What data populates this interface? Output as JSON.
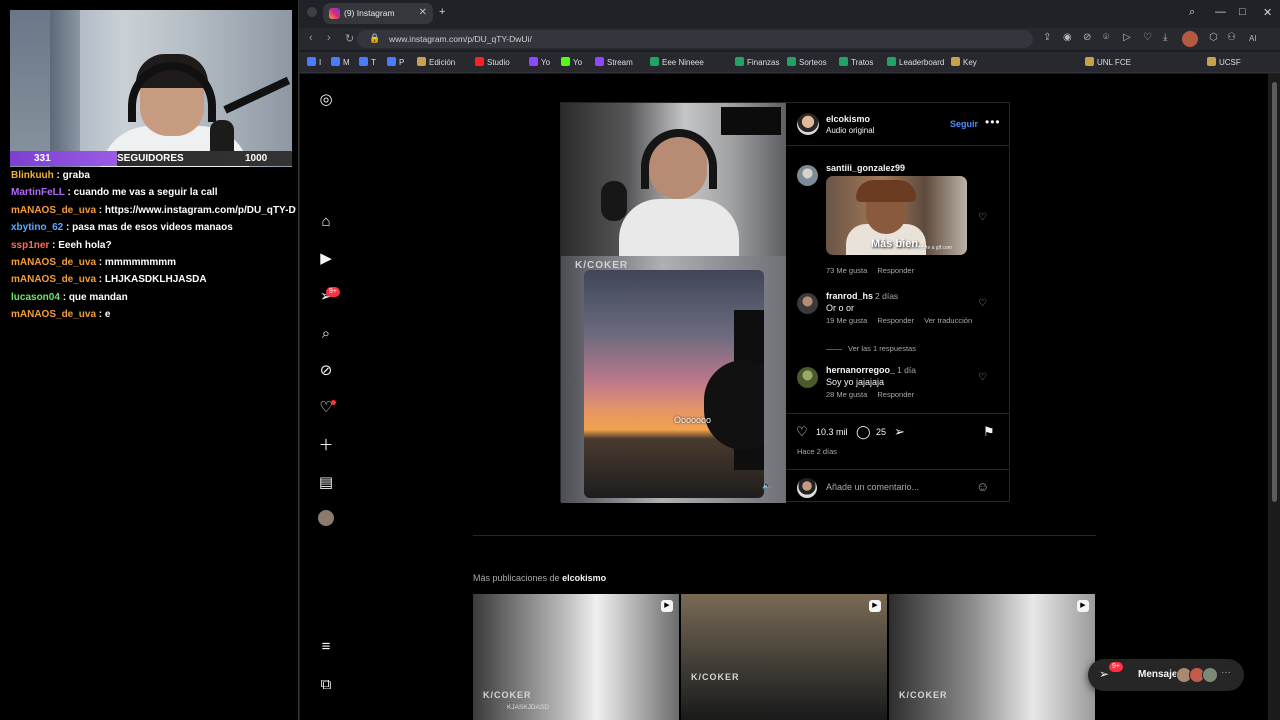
{
  "stream": {
    "followers": {
      "current": "331",
      "label": "SEGUIDORES",
      "goal": "1000"
    },
    "chat": [
      {
        "user": "Blinkuuh",
        "color": "#f0b232",
        "text": "graba"
      },
      {
        "user": "MartinFeLL",
        "color": "#b06bf5",
        "text": "cuando me vas a seguir la call"
      },
      {
        "user": "mANAOS_de_uva",
        "color": "#f59e3a",
        "text": "https://www.instagram.com/p/DU_qTY-DwUi/"
      },
      {
        "user": "xbytino_62",
        "color": "#5fa8ff",
        "text": "pasa mas de esos videos manaos"
      },
      {
        "user": "ssp1ner",
        "color": "#ff6b5a",
        "text": "Eeeh hola?"
      },
      {
        "user": "mANAOS_de_uva",
        "color": "#f59e3a",
        "text": "mmmmmmmm"
      },
      {
        "user": "mANAOS_de_uva",
        "color": "#f59e3a",
        "text": "LHJKASDKLHJASDA"
      },
      {
        "user": "lucason04",
        "color": "#6ee36e",
        "text": "que mandan"
      },
      {
        "user": "mANAOS_de_uva",
        "color": "#f59e3a",
        "text": "e"
      }
    ]
  },
  "browser": {
    "tab_title": "(9) Instagram",
    "url": "www.instagram.com/p/DU_qTY-DwUi/",
    "ai_label": "AI",
    "bookmarks": [
      {
        "label": "I",
        "color": "#4a7cff"
      },
      {
        "label": "M",
        "color": "#4a7cff"
      },
      {
        "label": "T",
        "color": "#4a7cff"
      },
      {
        "label": "P",
        "color": "#4a7cff"
      },
      {
        "label": "Edición",
        "color": "#c8a24a"
      },
      {
        "label": "Studio",
        "color": "#ff2020"
      },
      {
        "label": "Yo",
        "color": "#9146ff"
      },
      {
        "label": "Yo",
        "color": "#53fc18"
      },
      {
        "label": "Stream",
        "color": "#9146ff"
      },
      {
        "label": "Eee Nineee",
        "color": "#21a366"
      },
      {
        "label": "Finanzas",
        "color": "#21a366"
      },
      {
        "label": "Sorteos",
        "color": "#21a366"
      },
      {
        "label": "Tratos",
        "color": "#21a366"
      },
      {
        "label": "Leaderboard",
        "color": "#21a366"
      },
      {
        "label": "Key",
        "color": "#c8a24a"
      },
      {
        "label": "UNL FCE",
        "color": "#c8a24a"
      },
      {
        "label": "UCSF",
        "color": "#c8a24a"
      }
    ]
  },
  "post": {
    "author": "elcokismo",
    "audio": "Audio original",
    "follow_label": "Seguir",
    "media_watermark": "K/COKER",
    "media_caption": "Ooooooo",
    "comments": [
      {
        "user": "santiii_gonzalez99",
        "gif_caption": "Más bien...",
        "gif_watermark": "make a gif.com",
        "likes": "73 Me gusta",
        "reply": "Responder"
      },
      {
        "user": "franrod_hs",
        "time": "2 días",
        "text": "Or o or",
        "likes": "19 Me gusta",
        "reply": "Responder",
        "translate": "Ver traducción"
      },
      {
        "user": "hernanorregoo_",
        "time": "1 día",
        "text": "Soy yo jajajaja",
        "likes": "28 Me gusta",
        "reply": "Responder"
      }
    ],
    "view_replies": "Ver las 1 respuestas",
    "like_count": "10.3 mil",
    "comment_count": "25",
    "posted_ago": "Hace 2 días",
    "add_comment_placeholder": "Añade un comentario..."
  },
  "more": {
    "prefix": "Más publicaciones de",
    "author": "elcokismo",
    "thumb_watermark": "K/COKER",
    "thumb_label": "KJASKJDASD"
  },
  "messages": {
    "label": "Mensajes",
    "badge": "9+"
  },
  "nav": {
    "notif_badge": "9+"
  }
}
